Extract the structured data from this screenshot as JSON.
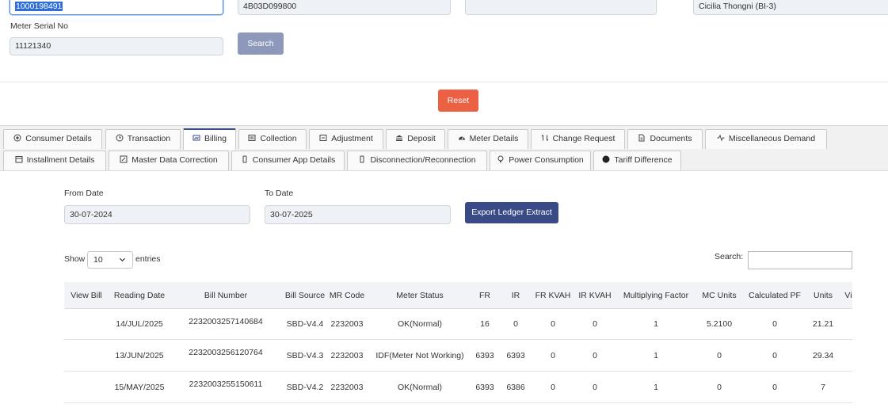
{
  "filters": {
    "field1_value": "1000198491",
    "field2_value": "4B03D099800",
    "field3_value": "",
    "field4_value": "Cicilia Thongni (BI-3)",
    "meter_serial_label": "Meter Serial No",
    "meter_serial_value": "11121340",
    "search_label": "Search",
    "reset_label": "Reset"
  },
  "tabs_row1": [
    {
      "label": "Consumer Details",
      "icon": "target-icon"
    },
    {
      "label": "Transaction",
      "icon": "clock-icon"
    },
    {
      "label": "Billing",
      "icon": "bill-icon",
      "active": true
    },
    {
      "label": "Collection",
      "icon": "list-icon"
    },
    {
      "label": "Adjustment",
      "icon": "adjust-icon"
    },
    {
      "label": "Deposit",
      "icon": "bank-icon"
    },
    {
      "label": "Meter Details",
      "icon": "gauge-icon"
    },
    {
      "label": "Change Request",
      "icon": "swap-icon"
    },
    {
      "label": "Documents",
      "icon": "document-icon"
    },
    {
      "label": "Miscellaneous Demand",
      "icon": "pulse-icon"
    }
  ],
  "tabs_row2": [
    {
      "label": "Installment Details",
      "icon": "calendar-icon"
    },
    {
      "label": "Master Data Correction",
      "icon": "edit-icon"
    },
    {
      "label": "Consumer App Details",
      "icon": "phone-icon"
    },
    {
      "label": "Disconnection/Reconnection",
      "icon": "phone-icon"
    },
    {
      "label": "Power Consumption",
      "icon": "bulb-icon"
    },
    {
      "label": "Tariff Difference",
      "icon": "circle-icon"
    }
  ],
  "billing": {
    "from_date_label": "From Date",
    "from_date_value": "30-07-2024",
    "to_date_label": "To Date",
    "to_date_value": "30-07-2025",
    "export_label": "Export Ledger Extract",
    "show_label": "Show",
    "entries_value": "10",
    "entries_label": "entries",
    "search_label": "Search:"
  },
  "table": {
    "headers": [
      "View Bill",
      "Reading Date",
      "Bill Number",
      "Bill Source",
      "MR Code",
      "Meter Status",
      "FR",
      "IR",
      "FR KVAH",
      "IR KVAH",
      "Multiplying Factor",
      "MC Units",
      "Calculated PF",
      "Units",
      "Vi"
    ],
    "rows": [
      [
        "",
        "14/JUL/2025",
        "2232003257140684",
        "SBD-V4.4",
        "2232003",
        "OK(Normal)",
        "16",
        "0",
        "0",
        "0",
        "1",
        "5.2100",
        "0",
        "21.21"
      ],
      [
        "",
        "13/JUN/2025",
        "2232003256120764",
        "SBD-V4.3",
        "2232003",
        "IDF(Meter Not Working)",
        "6393",
        "6393",
        "0",
        "0",
        "1",
        "0",
        "0",
        "29.34"
      ],
      [
        "",
        "15/MAY/2025",
        "2232003255150611",
        "SBD-V4.2",
        "2232003",
        "OK(Normal)",
        "6393",
        "6386",
        "0",
        "0",
        "1",
        "0",
        "0",
        "7"
      ]
    ]
  }
}
